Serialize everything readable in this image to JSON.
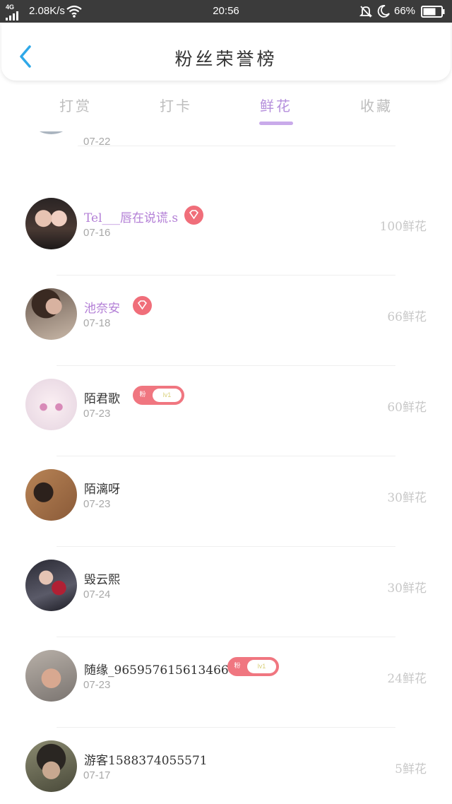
{
  "status_bar": {
    "network": "4G",
    "speed": "2.08K/s",
    "time": "20:56",
    "battery": "66%"
  },
  "header": {
    "title": "粉丝荣誉榜"
  },
  "tabs": [
    {
      "label": "打赏",
      "active": false
    },
    {
      "label": "打卡",
      "active": false
    },
    {
      "label": "鲜花",
      "active": true
    },
    {
      "label": "收藏",
      "active": false
    }
  ],
  "partial_row": {
    "date": "07-22"
  },
  "rows": [
    {
      "name": "Tel___唇在说谎.s",
      "date": "07-16",
      "count": "100鲜花",
      "vip": true,
      "badge": null
    },
    {
      "name": "池奈安",
      "date": "07-18",
      "count": "66鲜花",
      "vip": true,
      "badge": null
    },
    {
      "name": "陌君歌",
      "date": "07-23",
      "count": "60鲜花",
      "vip": false,
      "badge": {
        "left": "粉",
        "right": "lv1"
      }
    },
    {
      "name": "陌漓呀",
      "date": "07-23",
      "count": "30鲜花",
      "vip": false,
      "badge": null
    },
    {
      "name": "毁云熙",
      "date": "07-24",
      "count": "30鲜花",
      "vip": false,
      "badge": null
    },
    {
      "name": "随缘_96595761561346665",
      "date": "07-23",
      "count": "24鲜花",
      "vip": false,
      "badge": {
        "left": "粉",
        "right": "lv1"
      }
    },
    {
      "name": "游客1588374055571",
      "date": "07-17",
      "count": "5鲜花",
      "vip": false,
      "badge": null
    }
  ],
  "colors": {
    "accent": "#b58fdc",
    "back_arrow": "#2fa8e8",
    "badge": "#f07680",
    "status_bar": "#3b3b3b"
  },
  "icons": {
    "back": "chevron-left-icon",
    "vip": "diamond-icon",
    "wifi": "wifi-icon",
    "bell": "bell-muted-icon",
    "moon": "moon-icon",
    "battery": "battery-icon"
  }
}
